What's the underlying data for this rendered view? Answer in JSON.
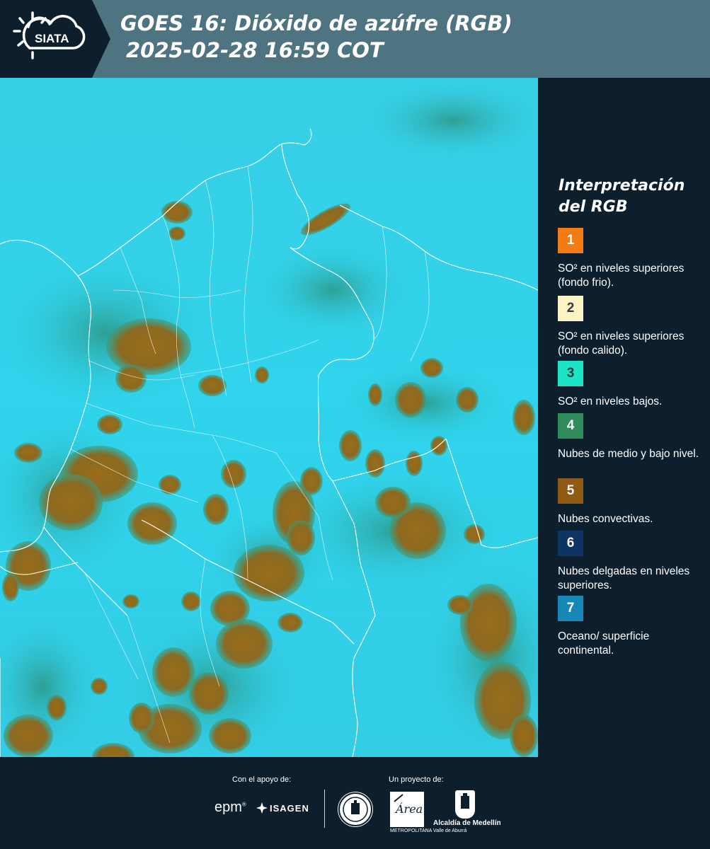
{
  "header": {
    "logo_text": "SIATA",
    "title_line1": "GOES 16: Dióxido de azúfre (RGB)",
    "title_line2": "2025-02-28 16:59 COT"
  },
  "legend": {
    "title": "Interpretación del RGB",
    "items": [
      {
        "number": "1",
        "label": "SO² en niveles superiores (fondo frio).",
        "color": "#f57c15",
        "text_color": "#ffffff"
      },
      {
        "number": "2",
        "label": "SO² en niveles superiores (fondo calido).",
        "color": "#fcf3c4",
        "text_color": "#3a3a3a"
      },
      {
        "number": "3",
        "label": "SO² en niveles bajos.",
        "color": "#1de4c6",
        "text_color": "#0d3a3a"
      },
      {
        "number": "4",
        "label": "Nubes de medio y bajo nivel.",
        "color": "#2f8c5c",
        "text_color": "#ffffff"
      },
      {
        "number": "5",
        "label": "Nubes convectivas.",
        "color": "#8f5a14",
        "text_color": "#ffffff"
      },
      {
        "number": "6",
        "label": "Nubes delgadas en niveles superiores.",
        "color": "#0e3464",
        "text_color": "#ffffff"
      },
      {
        "number": "7",
        "label": "Oceano/ superficie continental.",
        "color": "#1588b8",
        "text_color": "#ffffff"
      }
    ]
  },
  "map": {
    "background_color": "#2fd2ec",
    "cloud_color": "#8f6a1c",
    "border_color": "#ffffff"
  },
  "footer": {
    "support_label": "Con el apoyo de:",
    "project_label": "Un proyecto de:",
    "sponsor_1": "epm",
    "sponsor_2": "ISAGEN",
    "area_logo_text": "Área",
    "area_caption": "METROPOLITANA Valle de Aburrá",
    "alcaldia_label": "Alcaldía de Medellín"
  }
}
